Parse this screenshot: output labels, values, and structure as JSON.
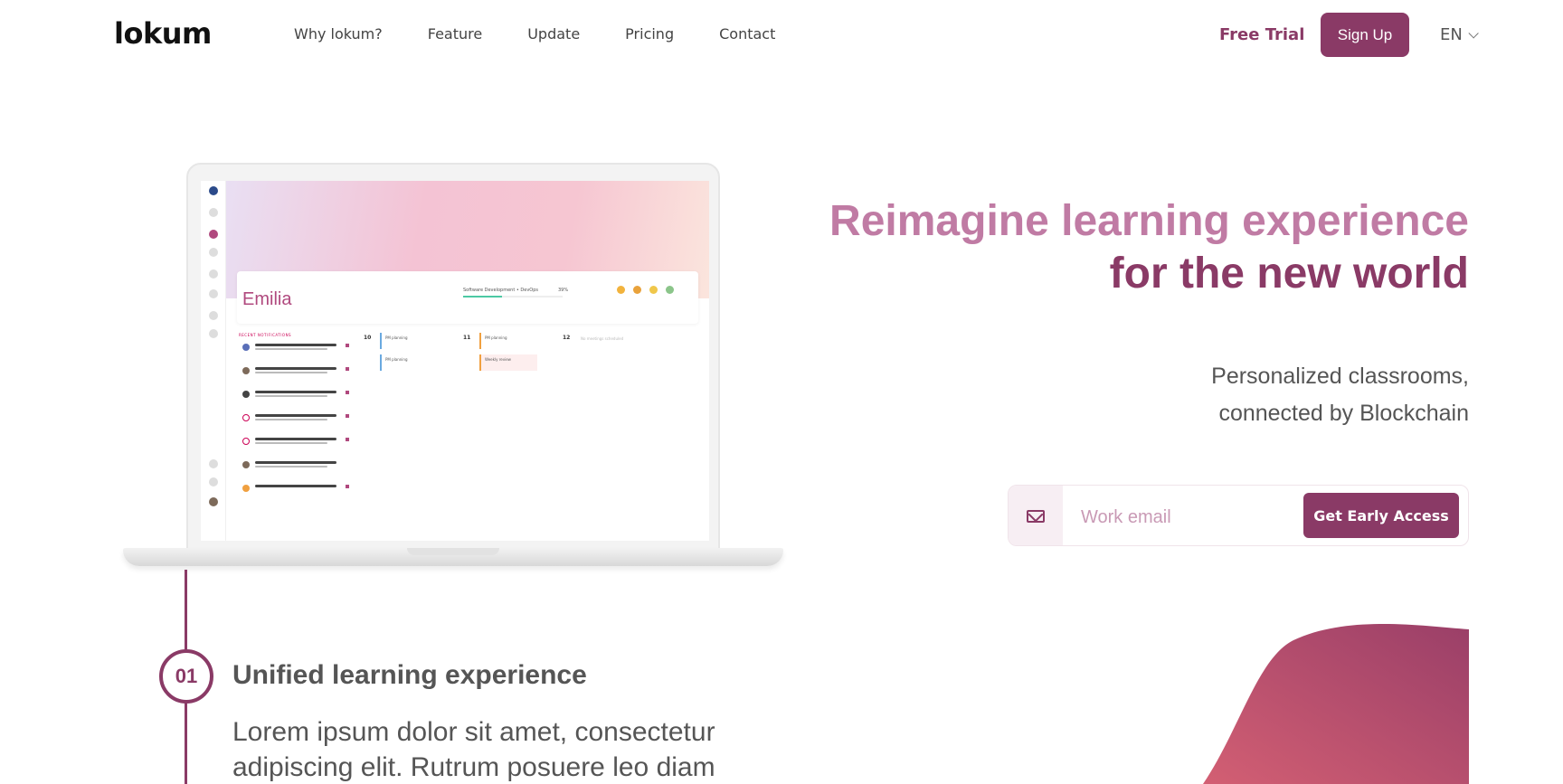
{
  "nav": {
    "logo": "lokum",
    "links": [
      "Why lokum?",
      "Feature",
      "Update",
      "Pricing",
      "Contact"
    ],
    "free_trial": "Free Trial",
    "signup": "Sign Up",
    "language": "EN"
  },
  "laptop": {
    "user_name": "Emilia",
    "course": "Software Development • DevOps",
    "course_progress_label": "39%",
    "course_progress": 0.39,
    "notifications_header": "RECENT NOTIFICATIONS",
    "calendar_days": [
      "10",
      "11",
      "12"
    ],
    "events": [
      "PM planning",
      "PM planning",
      "Weekly review"
    ],
    "no_meetings": "No meetings scheduled"
  },
  "hero": {
    "title_line1": "Reimagine learning experience",
    "title_line2": "for the new world",
    "subtitle_line1": "Personalized classrooms,",
    "subtitle_line2": "connected by Blockchain"
  },
  "signup_form": {
    "email_placeholder": "Work email",
    "cta": "Get Early Access"
  },
  "features": [
    {
      "number": "01",
      "title": "Unified learning experience",
      "body": "Lorem ipsum dolor sit amet, consectetur adipiscing elit. Rutrum posuere leo diam"
    }
  ],
  "colors": {
    "brand": "#8a3a66",
    "brand_light": "#c07ba4"
  }
}
